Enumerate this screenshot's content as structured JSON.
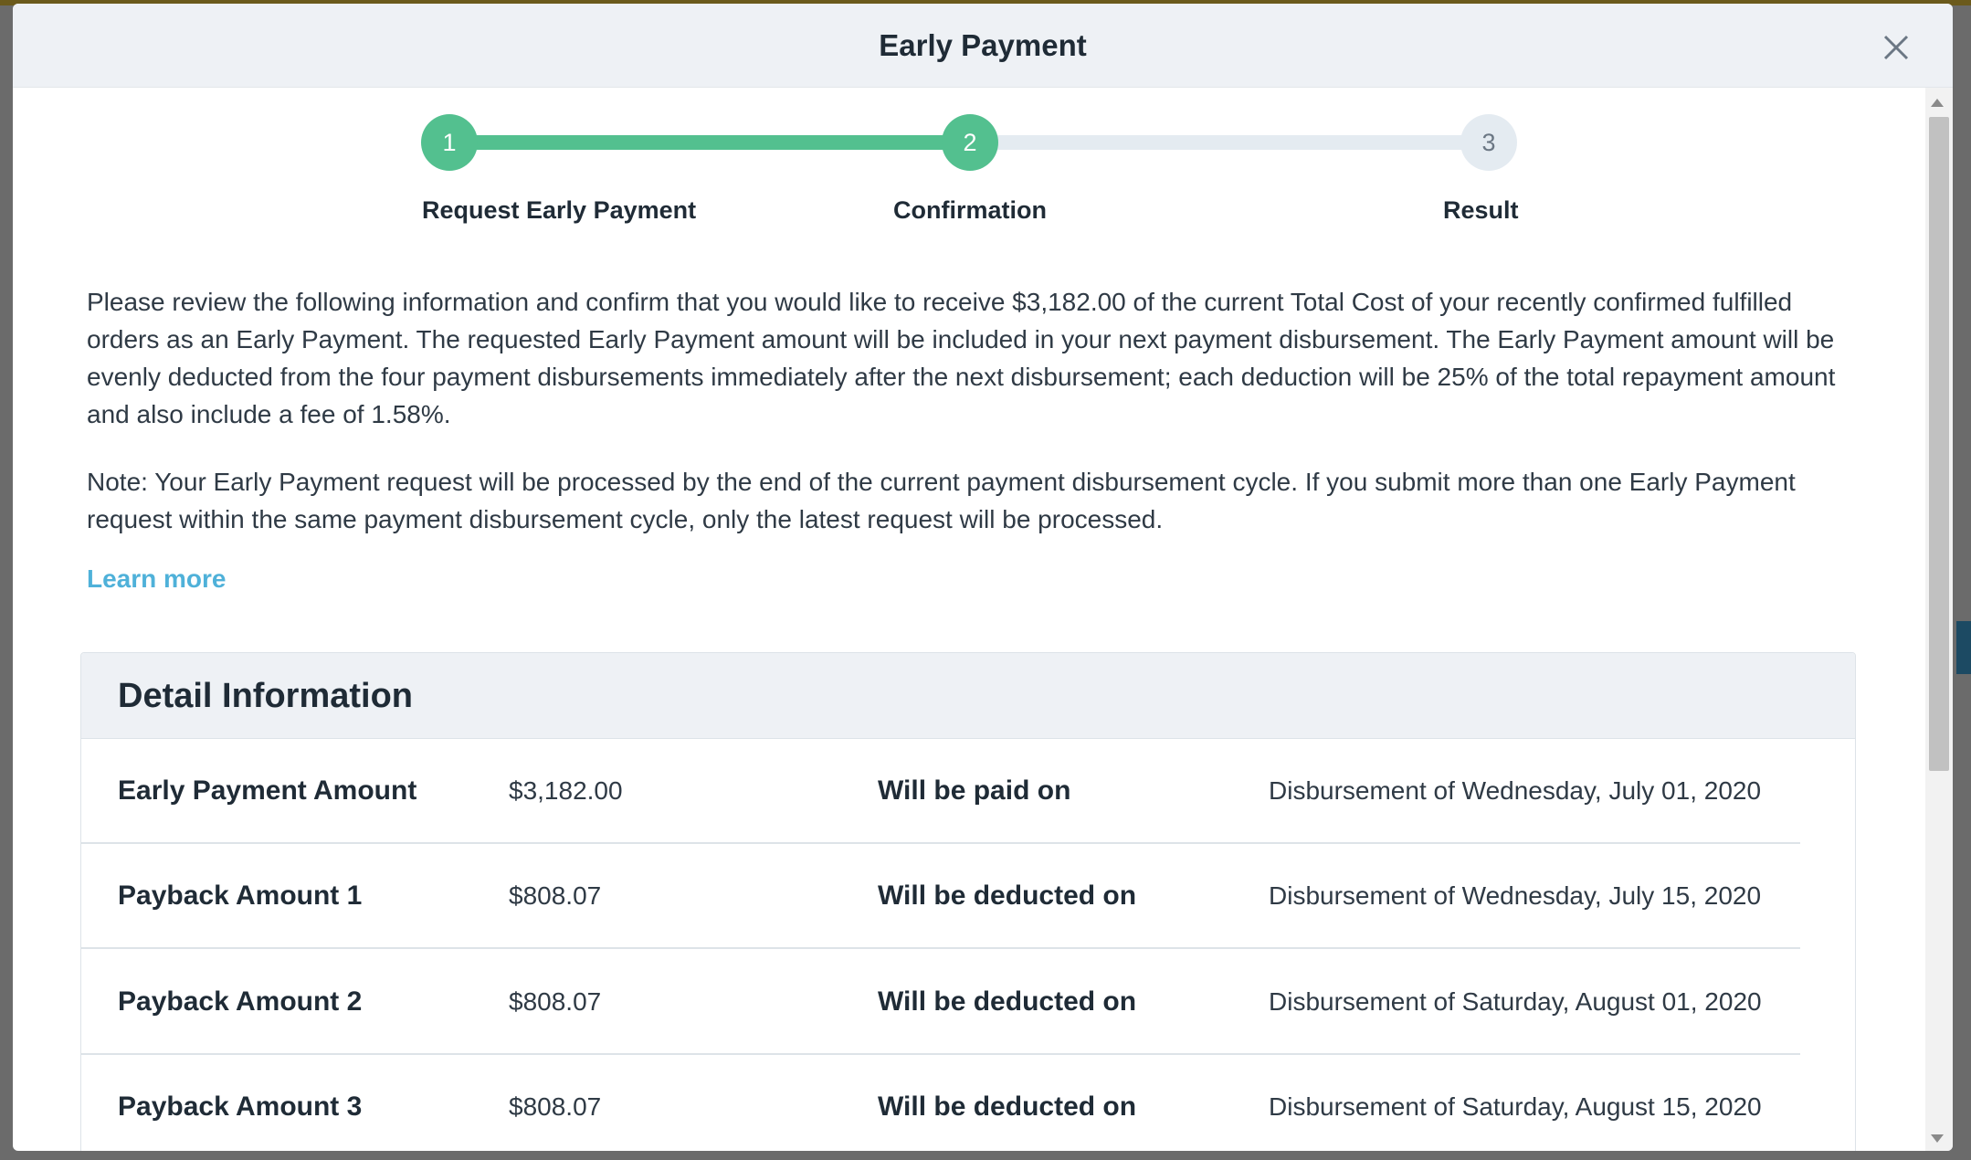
{
  "modal": {
    "title": "Early Payment"
  },
  "stepper": {
    "steps": [
      {
        "number": "1",
        "label": "Request Early Payment",
        "state": "done"
      },
      {
        "number": "2",
        "label": "Confirmation",
        "state": "current"
      },
      {
        "number": "3",
        "label": "Result",
        "state": "todo"
      }
    ],
    "colors": {
      "done": "#53c08f",
      "todo": "#e4ebf1"
    }
  },
  "body": {
    "paragraph1": "Please review the following information and confirm that you would like to receive $3,182.00 of the current Total Cost of your recently confirmed fulfilled orders as an Early Payment. The requested Early Payment amount will be included in your next payment disbursement. The Early Payment amount will be evenly deducted from the four payment disbursements immediately after the next disbursement; each deduction will be 25% of the total repayment amount and also include a fee of 1.58%.",
    "paragraph2": "Note: Your Early Payment request will be processed by the end of the current payment disbursement cycle. If you submit more than one Early Payment request within the same payment disbursement cycle, only the latest request will be processed.",
    "learn_more": "Learn more"
  },
  "detail": {
    "title": "Detail Information",
    "rows": [
      {
        "label": "Early Payment Amount",
        "amount": "$3,182.00",
        "when_label": "Will be paid on",
        "date": "Disbursement of Wednesday, July 01, 2020"
      },
      {
        "label": "Payback Amount 1",
        "amount": "$808.07",
        "when_label": "Will be deducted on",
        "date": "Disbursement of Wednesday, July 15, 2020"
      },
      {
        "label": "Payback Amount 2",
        "amount": "$808.07",
        "when_label": "Will be deducted on",
        "date": "Disbursement of Saturday, August 01, 2020"
      },
      {
        "label": "Payback Amount 3",
        "amount": "$808.07",
        "when_label": "Will be deducted on",
        "date": "Disbursement of Saturday, August 15, 2020"
      }
    ]
  },
  "colors": {
    "accent_green": "#53c08f",
    "link_blue": "#4fb1d9",
    "header_bg": "#eef1f5"
  }
}
